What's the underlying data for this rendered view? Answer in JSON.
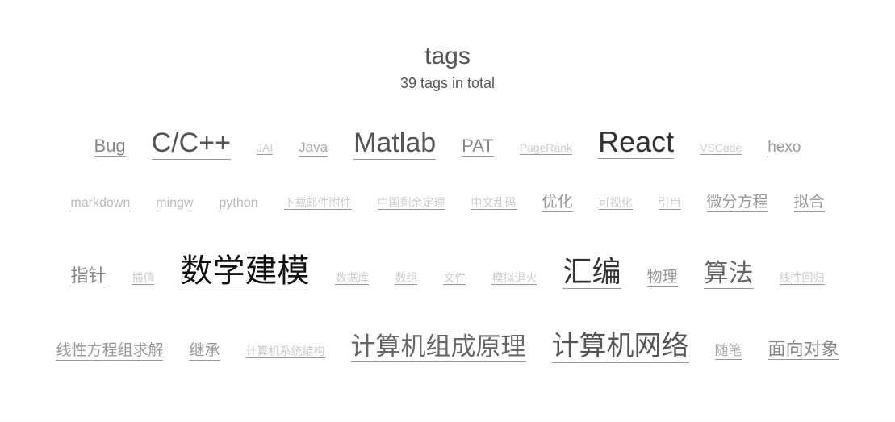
{
  "header": {
    "title": "tags",
    "subtitle": "39 tags in total"
  },
  "rows": [
    [
      {
        "label": "Bug",
        "level": 5
      },
      {
        "label": "C/C++",
        "level": 8
      },
      {
        "label": "JAI",
        "level": 1
      },
      {
        "label": "Java",
        "level": 3
      },
      {
        "label": "Matlab",
        "level": 8
      },
      {
        "label": "PAT",
        "level": 5
      },
      {
        "label": "PageRank",
        "level": 1
      },
      {
        "label": "React",
        "level": 9
      },
      {
        "label": "VSCode",
        "level": 1
      },
      {
        "label": "hexo",
        "level": 4
      }
    ],
    [
      {
        "label": "markdown",
        "level": 2
      },
      {
        "label": "mingw",
        "level": 2
      },
      {
        "label": "python",
        "level": 2
      },
      {
        "label": "下载邮件附件",
        "level": 1
      },
      {
        "label": "中国剩余定理",
        "level": 1
      },
      {
        "label": "中文乱码",
        "level": 1
      },
      {
        "label": "优化",
        "level": 4
      },
      {
        "label": "可视化",
        "level": 1
      },
      {
        "label": "引用",
        "level": 1
      },
      {
        "label": "微分方程",
        "level": 4
      },
      {
        "label": "拟合",
        "level": 4
      }
    ],
    [
      {
        "label": "指针",
        "level": 5
      },
      {
        "label": "插值",
        "level": 1
      },
      {
        "label": "数学建模",
        "level": 10
      },
      {
        "label": "数据库",
        "level": 1
      },
      {
        "label": "数组",
        "level": 1
      },
      {
        "label": "文件",
        "level": 1
      },
      {
        "label": "模拟退火",
        "level": 1
      },
      {
        "label": "汇编",
        "level": 9
      },
      {
        "label": "物理",
        "level": 4
      },
      {
        "label": "算法",
        "level": 7
      },
      {
        "label": "线性回归",
        "level": 1
      }
    ],
    [
      {
        "label": "线性方程组求解",
        "level": 4
      },
      {
        "label": "继承",
        "level": 4
      },
      {
        "label": "计算机系统结构",
        "level": 1
      },
      {
        "label": "计算机组成原理",
        "level": 7
      },
      {
        "label": "计算机网络",
        "level": 8
      },
      {
        "label": "随笔",
        "level": 3
      },
      {
        "label": "面向对象",
        "level": 5
      }
    ]
  ]
}
